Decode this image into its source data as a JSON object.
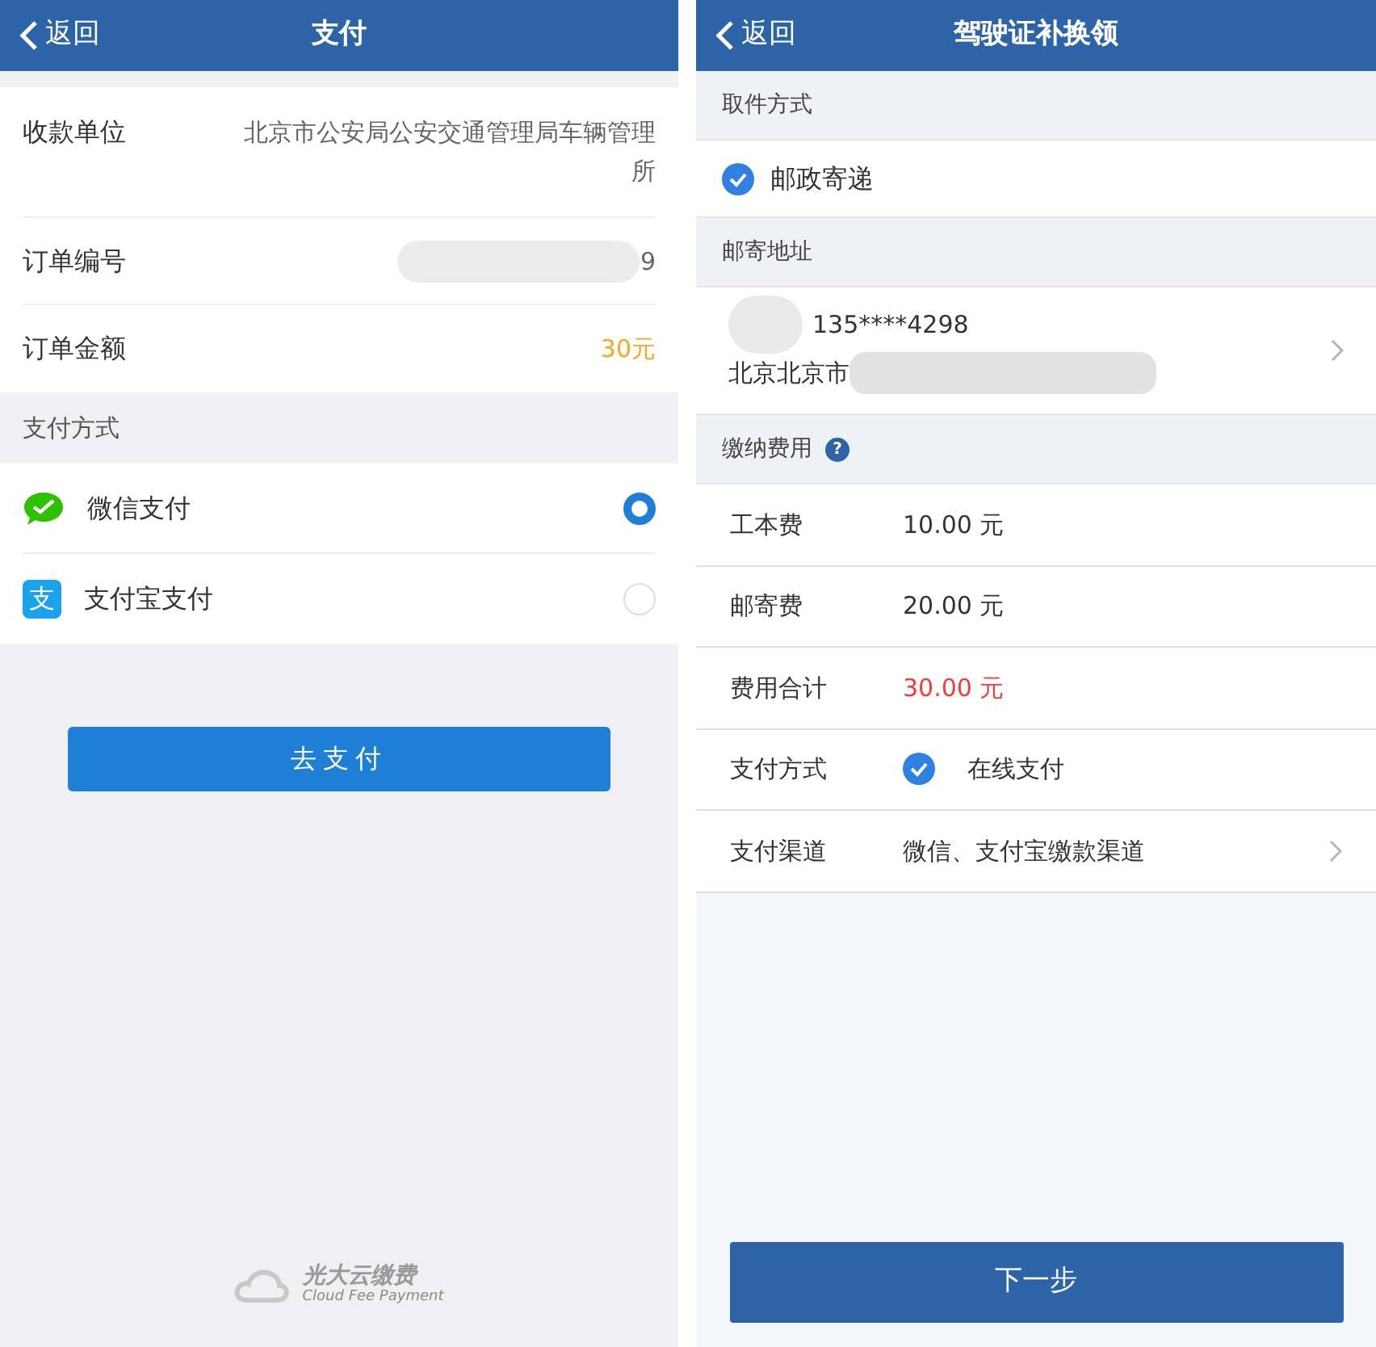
{
  "payment_screen": {
    "header": {
      "back": "返回",
      "title": "支付"
    },
    "order": [
      {
        "label": "收款单位",
        "value": "北京市公安局公安交通管理局车辆管理所",
        "kind": "plain"
      },
      {
        "label": "订单编号",
        "value": "9",
        "kind": "blurred"
      },
      {
        "label": "订单金额",
        "value": "30元",
        "kind": "amount"
      }
    ],
    "method_heading": "支付方式",
    "methods": [
      {
        "label": "微信支付",
        "kind": "wechat",
        "selected": true
      },
      {
        "label": "支付宝支付",
        "kind": "alipay",
        "icon_text": "支",
        "selected": false
      }
    ],
    "pay_button": "去支付",
    "footer_logo": {
      "name": "光大云缴费",
      "tagline": "Cloud Fee Payment"
    }
  },
  "license_screen": {
    "header": {
      "back": "返回",
      "title": "驾驶证补换领"
    },
    "pickup_heading": "取件方式",
    "pickup_option": {
      "label": "邮政寄递",
      "checked": true
    },
    "address_heading": "邮寄地址",
    "address": {
      "phone": "135****4298",
      "line": "北京北京市"
    },
    "fees_heading": "缴纳费用",
    "fees_help": "?",
    "fees": [
      {
        "label": "工本费",
        "value": "10.00 元",
        "kind": "plain"
      },
      {
        "label": "邮寄费",
        "value": "20.00 元",
        "kind": "plain"
      },
      {
        "label": "费用合计",
        "value": "30.00 元",
        "kind": "total"
      },
      {
        "label": "支付方式",
        "value": "在线支付",
        "kind": "check",
        "checked": true
      },
      {
        "label": "支付渠道",
        "value": "微信、支付宝缴款渠道",
        "kind": "link"
      }
    ],
    "next_button": "下一步"
  }
}
